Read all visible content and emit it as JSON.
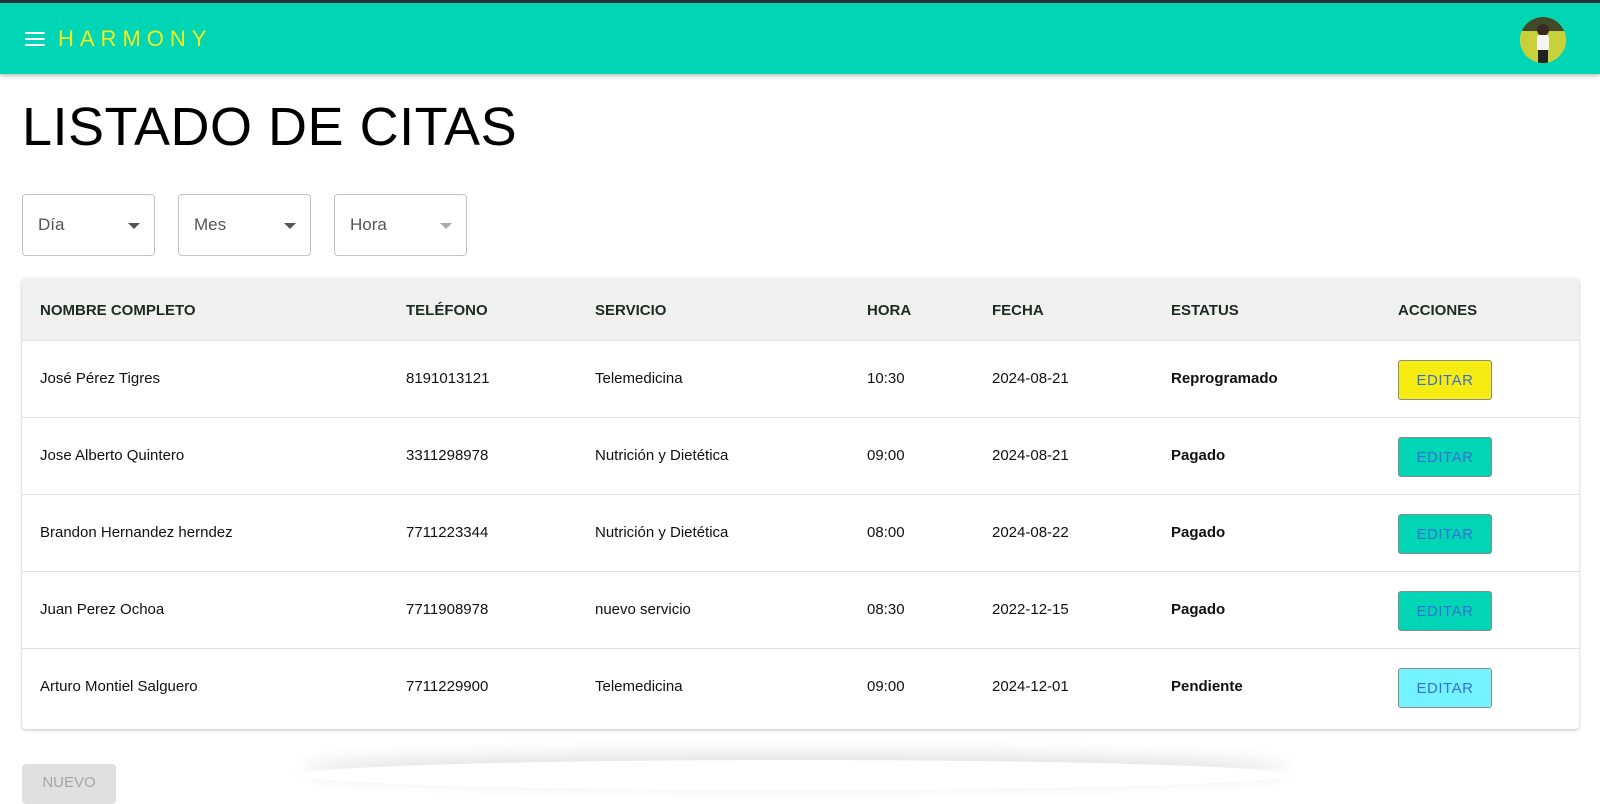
{
  "app": {
    "brand": "HARMONY",
    "colors": {
      "appbar": "#00d6b5",
      "brand_text": "#f2ea1d",
      "edit_reprogramado": "#f7ec11",
      "edit_pagado": "#00d6b5",
      "edit_pendiente": "#72f3ff"
    }
  },
  "page": {
    "title": "LISTADO DE CITAS"
  },
  "filters": [
    {
      "label": "Día",
      "disabled": false
    },
    {
      "label": "Mes",
      "disabled": false
    },
    {
      "label": "Hora",
      "disabled": true
    }
  ],
  "table": {
    "columns": [
      "NOMBRE COMPLETO",
      "TELÉFONO",
      "SERVICIO",
      "HORA",
      "FECHA",
      "ESTATUS",
      "ACCIONES"
    ],
    "rows": [
      {
        "nombre": "José Pérez Tigres",
        "telefono": "8191013121",
        "servicio": "Telemedicina",
        "hora": "10:30",
        "fecha": "2024-08-21",
        "estatus": "Reprogramado",
        "accion": "EDITAR"
      },
      {
        "nombre": "Jose Alberto Quintero",
        "telefono": "3311298978",
        "servicio": "Nutrición y Dietética",
        "hora": "09:00",
        "fecha": "2024-08-21",
        "estatus": "Pagado",
        "accion": "EDITAR"
      },
      {
        "nombre": "Brandon Hernandez herndez",
        "telefono": "7711223344",
        "servicio": "Nutrición y Dietética",
        "hora": "08:00",
        "fecha": "2024-08-22",
        "estatus": "Pagado",
        "accion": "EDITAR"
      },
      {
        "nombre": "Juan Perez Ochoa",
        "telefono": "7711908978",
        "servicio": "nuevo servicio",
        "hora": "08:30",
        "fecha": "2022-12-15",
        "estatus": "Pagado",
        "accion": "EDITAR"
      },
      {
        "nombre": "Arturo Montiel Salguero",
        "telefono": "7711229900",
        "servicio": "Telemedicina",
        "hora": "09:00",
        "fecha": "2024-12-01",
        "estatus": "Pendiente",
        "accion": "EDITAR"
      }
    ]
  },
  "actions": {
    "nuevo_label": "NUEVO"
  },
  "icons": {
    "menu": "menu-icon",
    "dropdown": "arrow-drop-down-icon",
    "avatar": "user-avatar"
  }
}
